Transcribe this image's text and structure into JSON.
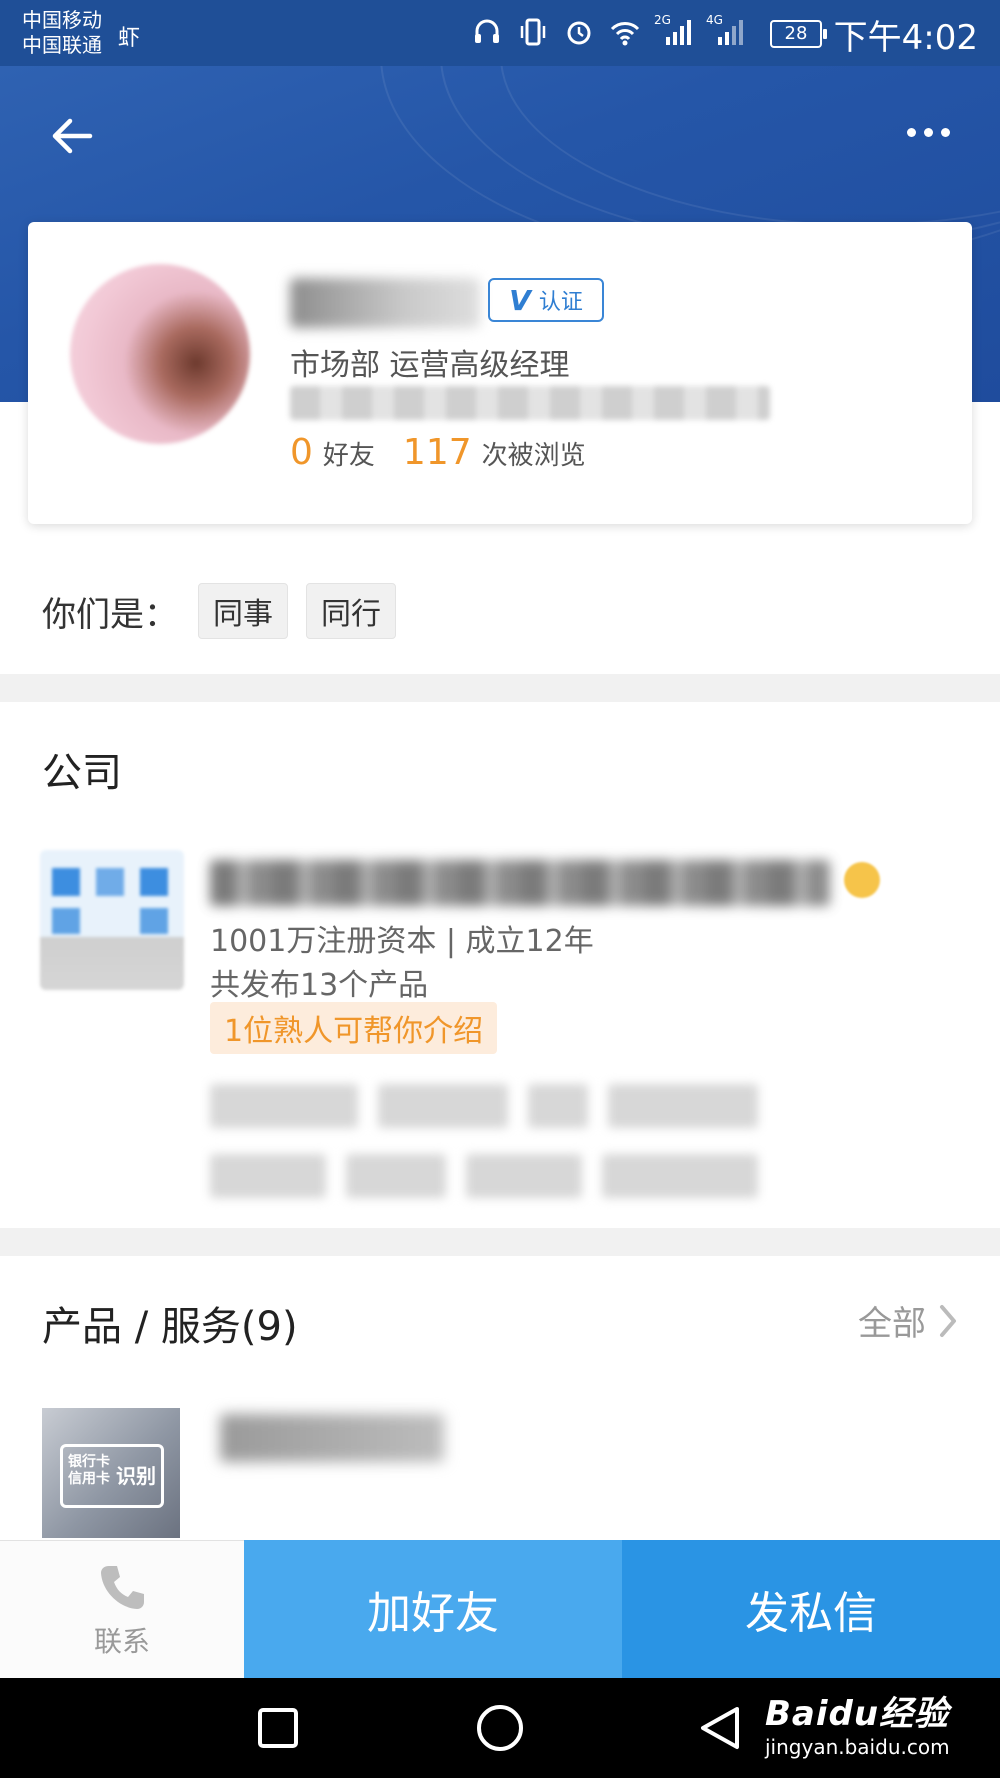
{
  "status_bar": {
    "carrier_1": "中国移动",
    "carrier_2": "中国联通",
    "carrier_icon_text": "虾",
    "network_1": "2G",
    "network_2": "4G",
    "battery": "28",
    "time": "下午4:02"
  },
  "profile": {
    "verified_label": "认证",
    "role": "市场部 运营高级经理",
    "friends_count": "0",
    "friends_label": "好友",
    "views_count": "117",
    "views_label": "次被浏览"
  },
  "relation": {
    "label": "你们是：",
    "tags": [
      "同事",
      "同行"
    ]
  },
  "company": {
    "section_title": "公司",
    "capital_line": "1001万注册资本 | 成立12年",
    "products_line": "共发布13个产品",
    "intro_badge": "1位熟人可帮你介绍"
  },
  "products": {
    "section_title": "产品 / 服务(9)",
    "all_label": "全部",
    "thumb_text_1": "银行卡",
    "thumb_text_2": "信用卡",
    "thumb_text_3": "识别"
  },
  "actions": {
    "contact_label": "联系",
    "add_friend_label": "加好友",
    "message_label": "发私信"
  },
  "watermark": {
    "brand": "Baidu经验",
    "url": "jingyan.baidu.com"
  },
  "colors": {
    "header_blue": "#2556a8",
    "accent_orange": "#f0962a",
    "add_friend_blue": "#49a9ee",
    "message_blue": "#2a94e4",
    "verify_blue": "#2f7ed2"
  },
  "icons": {
    "back": "arrow-left-icon",
    "more": "more-dots-icon",
    "contact": "phone-icon",
    "verified": "v-badge-icon",
    "crown": "crown-icon",
    "chevron": "chevron-right-icon"
  }
}
